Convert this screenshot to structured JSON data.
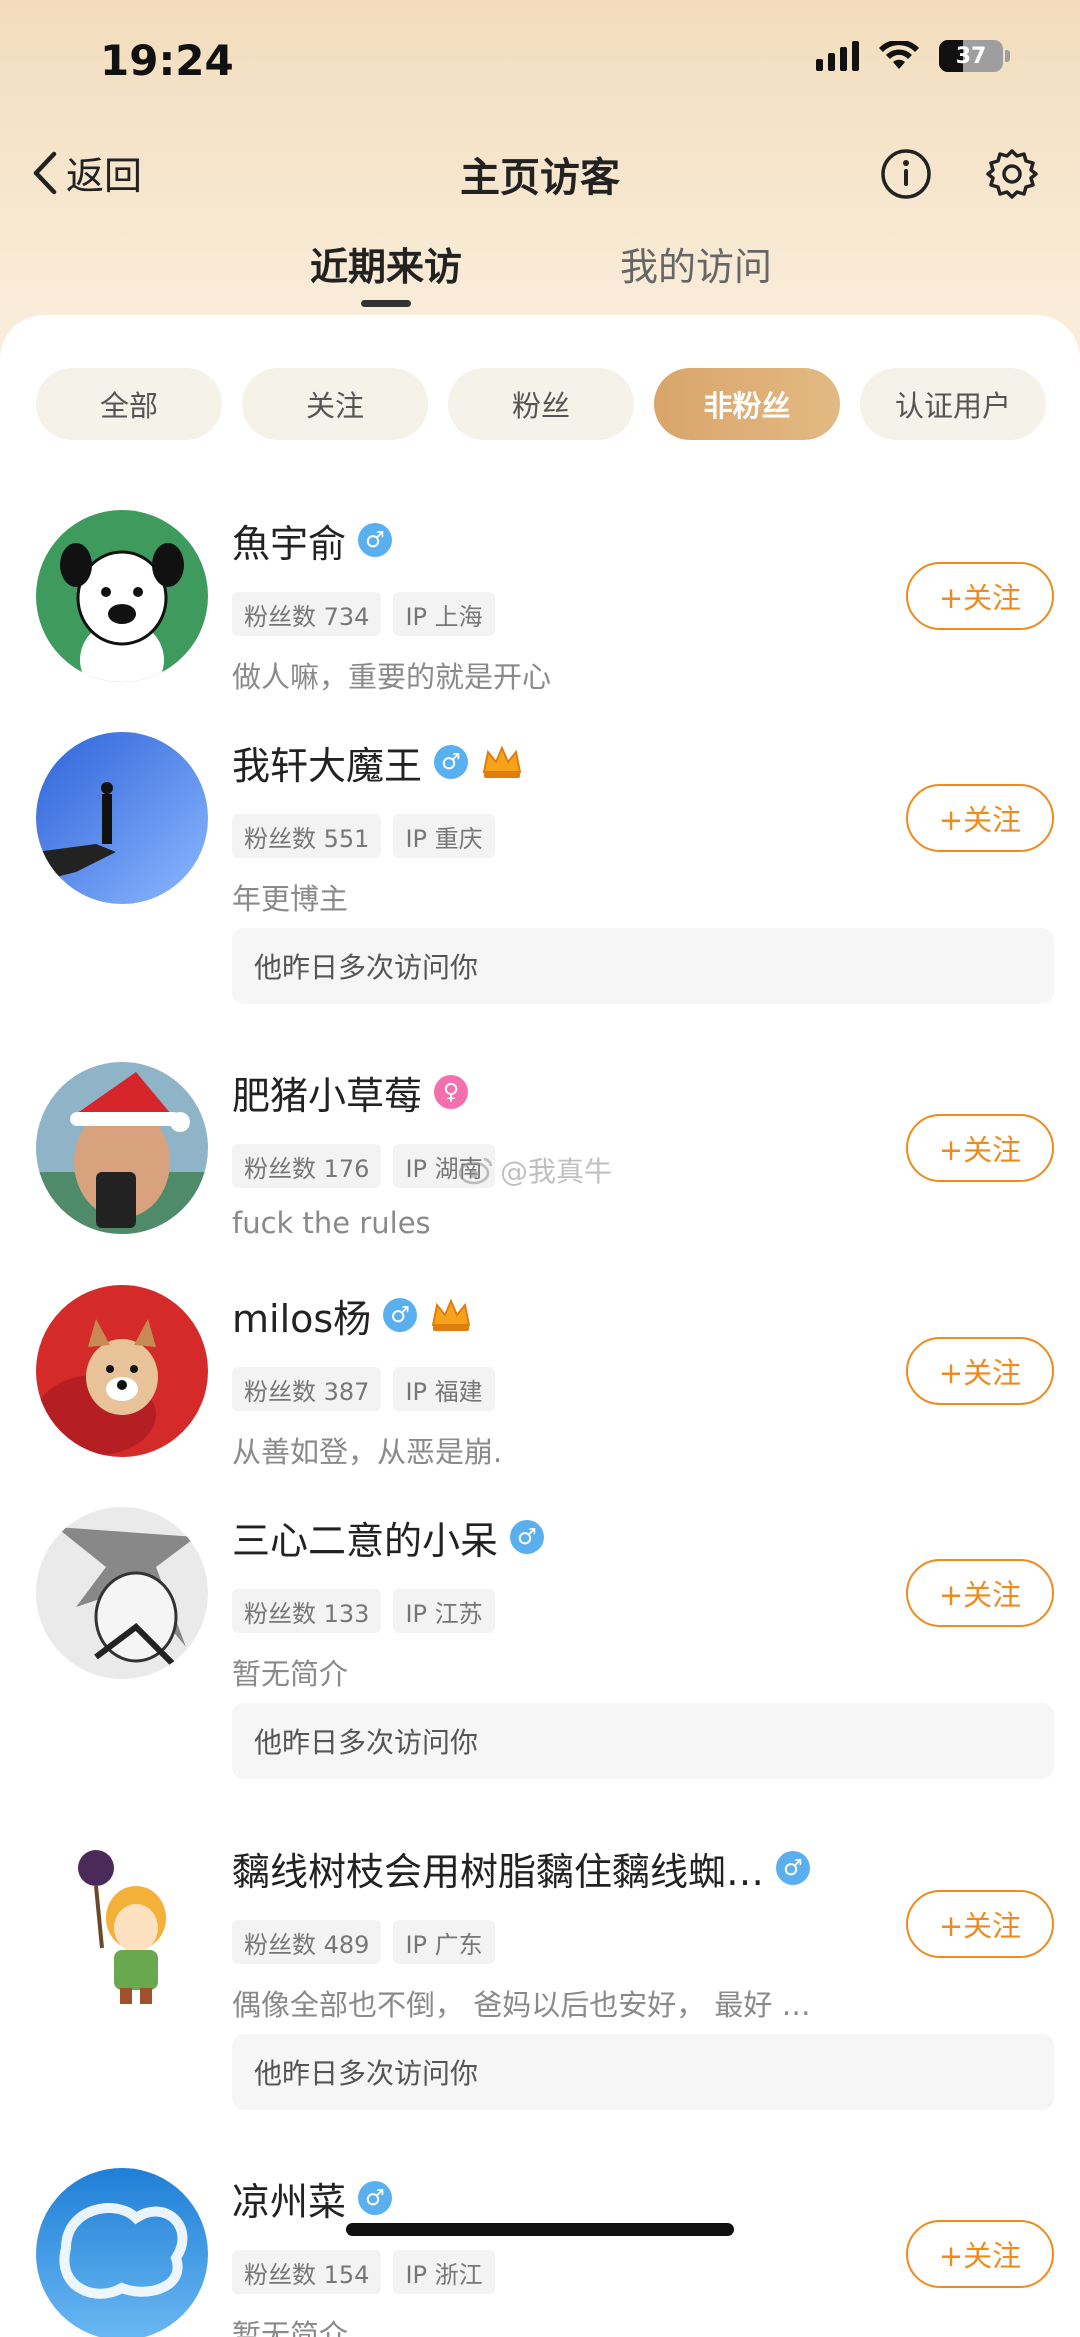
{
  "status_bar": {
    "time": "19:24",
    "battery": "37"
  },
  "nav": {
    "back_label": "返回",
    "title": "主页访客"
  },
  "tabs": [
    {
      "label": "近期来访"
    },
    {
      "label": "我的访问"
    }
  ],
  "filters": [
    {
      "label": "全部"
    },
    {
      "label": "关注"
    },
    {
      "label": "粉丝"
    },
    {
      "label": "非粉丝"
    },
    {
      "label": "认证用户"
    }
  ],
  "active_filter": "非粉丝",
  "visitors": [
    {
      "name": "魚宇俞",
      "gender": "♂",
      "fans": "粉丝数 734",
      "ip": "IP 上海",
      "bio": "做人嘛，重要的就是开心",
      "follow_label": "+关注"
    },
    {
      "name": "我轩大魔王",
      "gender": "♂",
      "fans": "粉丝数 551",
      "ip": "IP 重庆",
      "bio": "年更博主",
      "follow_label": "+关注",
      "note": "他昨日多次访问你"
    },
    {
      "name": "肥猪小草莓",
      "gender": "♀",
      "fans": "粉丝数 176",
      "ip": "IP 湖南",
      "bio": "fuck the rules",
      "follow_label": "+关注"
    },
    {
      "name": "milos杨",
      "gender": "♂",
      "fans": "粉丝数 387",
      "ip": "IP 福建",
      "bio": "从善如登，从恶是崩.",
      "follow_label": "+关注"
    },
    {
      "name": "三心二意的小呆",
      "gender": "♂",
      "fans": "粉丝数 133",
      "ip": "IP 江苏",
      "bio": "暂无简介",
      "follow_label": "+关注",
      "note": "他昨日多次访问你"
    },
    {
      "name": "黐线树枝会用树脂黐住黐线蜘…",
      "gender": "♂",
      "fans": "粉丝数 489",
      "ip": "IP 广东",
      "bio": "偶像全部也不倒， 爸妈以后也安好， 最好 …",
      "follow_label": "+关注",
      "note": "他昨日多次访问你"
    },
    {
      "name": "凉州菜",
      "gender": "♂",
      "fans": "粉丝数 154",
      "ip": "IP 浙江",
      "bio": "暂无简介",
      "follow_label": "+关注"
    }
  ],
  "watermark": "@我真牛",
  "colors": {
    "accent": "#f08a1c",
    "active_chip": "#dca86e",
    "male": "#5ab0ef",
    "female": "#f46fae"
  }
}
